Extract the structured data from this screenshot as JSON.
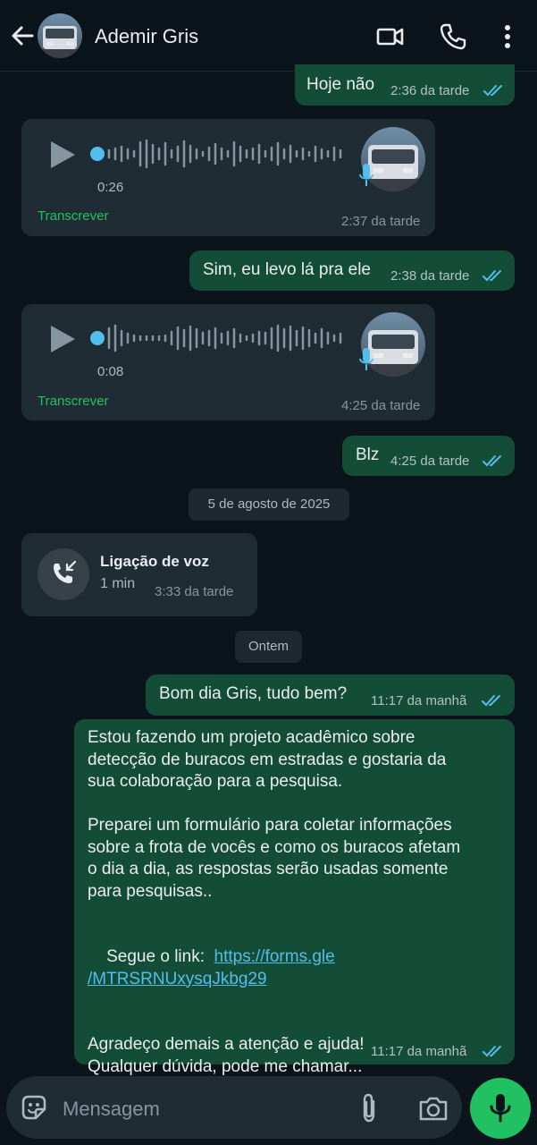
{
  "header": {
    "contact_name": "Ademir Gris",
    "icons": [
      "back-arrow-icon",
      "video-call-icon",
      "phone-icon",
      "more-options-icon"
    ]
  },
  "messages": [
    {
      "type": "text",
      "direction": "out",
      "text": "Hoje não",
      "time": "2:36 da tarde",
      "status": "read"
    },
    {
      "type": "voice",
      "direction": "in",
      "duration": "0:26",
      "transcribe": "Transcrever",
      "time": "2:37 da tarde"
    },
    {
      "type": "text",
      "direction": "out",
      "text": "Sim, eu levo lá pra ele",
      "time": "2:38 da tarde",
      "status": "read"
    },
    {
      "type": "voice",
      "direction": "in",
      "duration": "0:08",
      "transcribe": "Transcrever",
      "time": "4:25 da tarde"
    },
    {
      "type": "text",
      "direction": "out",
      "text": "Blz",
      "time": "4:25 da tarde",
      "status": "read"
    },
    {
      "type": "date",
      "text": "5 de agosto de 2025"
    },
    {
      "type": "call",
      "direction": "in",
      "title": "Ligação de voz",
      "duration": "1 min",
      "time": "3:33 da tarde"
    },
    {
      "type": "date",
      "text": "Ontem"
    },
    {
      "type": "text",
      "direction": "out",
      "text": "Bom dia Gris, tudo bem?",
      "time": "11:17 da manhã",
      "status": "read"
    },
    {
      "type": "long",
      "direction": "out",
      "p1": [
        "Estou fazendo um projeto acadêmico sobre",
        "detecção de buracos em estradas e gostaria da",
        "sua colaboração para a pesquisa."
      ],
      "p2": [
        "Preparei um formulário para coletar informações",
        "sobre a frota de vocês e como os buracos afetam",
        "o dia a dia, as respostas serão usadas somente",
        "para pesquisas.."
      ],
      "link_prefix": "Segue o link:  ",
      "link_line1": "https://forms.gle",
      "link_line2": "/MTRSRNUxysqJkbg29",
      "p4": [
        "Agradeço demais a atenção e ajuda!",
        "Qualquer dúvida, pode me chamar..."
      ],
      "time": "11:17 da manhã",
      "status": "read"
    }
  ],
  "composer": {
    "placeholder": "Mensagem",
    "icons": [
      "sticker-icon",
      "attach-icon",
      "camera-icon",
      "mic-icon"
    ]
  },
  "colors": {
    "background": "#0b141a",
    "outgoing_bubble": "#144d37",
    "incoming_bubble": "#1f2c34",
    "read_ticks": "#53bdeb",
    "accent_green": "#21c063"
  }
}
